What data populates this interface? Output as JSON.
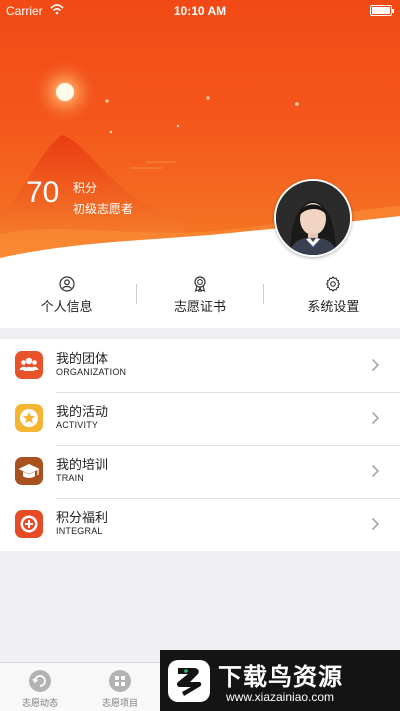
{
  "status_bar": {
    "carrier": "Carrier",
    "time": "10:10 AM"
  },
  "profile": {
    "points_value": "70",
    "points_unit": "积分",
    "level": "初级志愿者"
  },
  "quick_actions": [
    {
      "label": "个人信息",
      "icon": "person-icon"
    },
    {
      "label": "志愿证书",
      "icon": "medal-icon"
    },
    {
      "label": "系统设置",
      "icon": "gear-icon"
    }
  ],
  "menu": [
    {
      "title": "我的团体",
      "subtitle": "ORGANIZATION",
      "icon": "group-icon",
      "color": "#e8532a"
    },
    {
      "title": "我的活动",
      "subtitle": "ACTIVITY",
      "icon": "star-icon",
      "color": "#f3b532"
    },
    {
      "title": "我的培训",
      "subtitle": "TRAIN",
      "icon": "graduation-cap-icon",
      "color": "#a8511f"
    },
    {
      "title": "积分福利",
      "subtitle": "INTEGRAL",
      "icon": "points-icon",
      "color": "#e44b26"
    }
  ],
  "tabbar": [
    {
      "label": "志愿动态",
      "icon": "refresh-icon"
    },
    {
      "label": "志愿项目",
      "icon": "grid-icon"
    }
  ],
  "watermark": {
    "title": "下载鸟资源",
    "url": "www.xiazainiao.com"
  },
  "colors": {
    "header": "#f24a16",
    "background": "#efeff4",
    "accent": "#e8532a"
  }
}
